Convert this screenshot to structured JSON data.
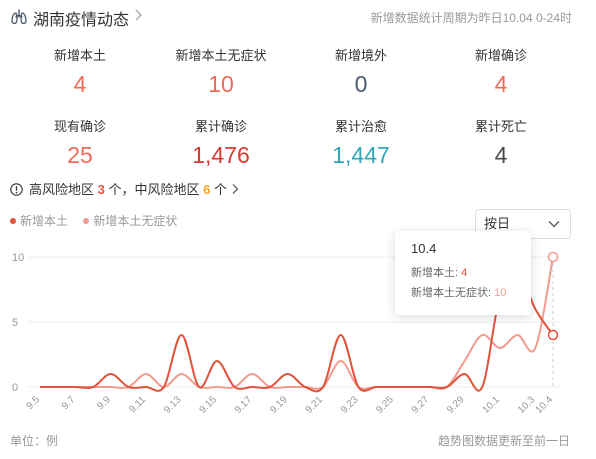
{
  "header": {
    "title": "湖南疫情动态",
    "period": "新增数据统计周期为昨日10.04 0-24时"
  },
  "stats": [
    {
      "label": "新增本土",
      "value": "4",
      "color": "#f06b57"
    },
    {
      "label": "新增本土无症状",
      "value": "10",
      "color": "#f06b57"
    },
    {
      "label": "新增境外",
      "value": "0",
      "color": "#4a5a6e"
    },
    {
      "label": "新增确诊",
      "value": "4",
      "color": "#f06b57"
    },
    {
      "label": "现有确诊",
      "value": "25",
      "color": "#f06b57"
    },
    {
      "label": "累计确诊",
      "value": "1,476",
      "color": "#d9392f"
    },
    {
      "label": "累计治愈",
      "value": "1,447",
      "color": "#2ea8b6"
    },
    {
      "label": "累计死亡",
      "value": "4",
      "color": "#4a4a4a"
    }
  ],
  "risk": {
    "prefix": "高风险地区",
    "high_count": "3",
    "middle_text": "个，中风险地区",
    "mid_count": "6",
    "suffix": "个"
  },
  "select": {
    "value": "按日"
  },
  "tooltip": {
    "date": "10.4",
    "row1_label": "新增本土:",
    "row1_value": "4",
    "row2_label": "新增本土无症状:",
    "row2_value": "10"
  },
  "footer": {
    "unit": "单位：例",
    "note": "趋势图数据更新至前一日"
  },
  "colors": {
    "series1": "#e0523a",
    "series2": "#f29c8f",
    "high": "#e0523a",
    "mid": "#f5a623"
  },
  "chart_data": {
    "type": "line",
    "x": [
      "9.5",
      "9.6",
      "9.7",
      "9.8",
      "9.9",
      "9.10",
      "9.11",
      "9.12",
      "9.13",
      "9.14",
      "9.15",
      "9.16",
      "9.17",
      "9.18",
      "9.19",
      "9.20",
      "9.21",
      "9.22",
      "9.23",
      "9.24",
      "9.25",
      "9.26",
      "9.27",
      "9.28",
      "9.29",
      "9.30",
      "10.1",
      "10.2",
      "10.3",
      "10.4"
    ],
    "x_tick_labels": [
      "9.5",
      "9.7",
      "9.9",
      "9.11",
      "9.13",
      "9.15",
      "9.17",
      "9.19",
      "9.21",
      "9.23",
      "9.25",
      "9.27",
      "9.29",
      "10.1",
      "10.3",
      "10.4"
    ],
    "ylim": [
      0,
      10
    ],
    "y_ticks": [
      "0",
      "5",
      "10"
    ],
    "series": [
      {
        "name": "新增本土",
        "values": [
          0,
          0,
          0,
          0,
          1,
          0,
          0,
          0,
          4,
          0,
          2,
          0,
          0,
          0,
          1,
          0,
          0,
          4,
          0,
          0,
          0,
          0,
          0,
          0,
          1,
          0,
          7,
          9,
          6,
          4
        ]
      },
      {
        "name": "新增本土无症状",
        "values": [
          0,
          0,
          0,
          0,
          0,
          0,
          1,
          0,
          1,
          0,
          0,
          0,
          1,
          0,
          0,
          0,
          0,
          2,
          0,
          0,
          0,
          0,
          0,
          0,
          2,
          4,
          3,
          4,
          3,
          10
        ]
      }
    ],
    "grid": true,
    "legend": "top-left"
  }
}
